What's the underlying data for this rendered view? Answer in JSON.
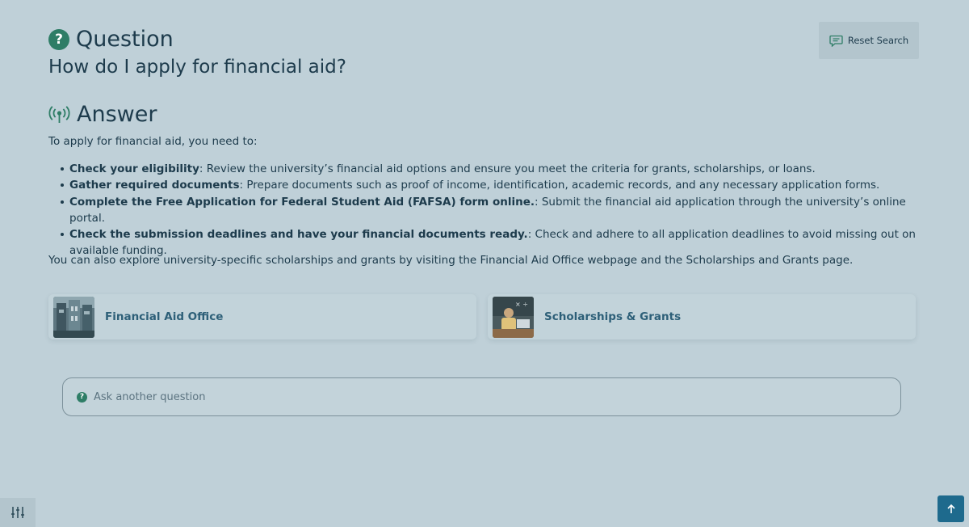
{
  "question": {
    "label": "Question",
    "icon": "question-circle-icon",
    "text": "How do I apply for financial aid?"
  },
  "toolbar": {
    "reset_label": "Reset Search",
    "reset_icon": "chat-bubble-icon"
  },
  "answer": {
    "label": "Answer",
    "icon": "broadcast-icon",
    "intro": "To apply for financial aid, you need to:",
    "items": [
      {
        "bold": "Check your eligibility",
        "text": ": Review the university’s financial aid options and ensure you meet the criteria for grants, scholarships, or loans."
      },
      {
        "bold": "Gather required documents",
        "text": ": Prepare documents such as proof of income, identification, academic records, and any necessary application forms."
      },
      {
        "bold": "Complete the Free Application for Federal Student Aid (FAFSA) form online.",
        "text": ": Submit the financial aid application through the university’s online portal."
      },
      {
        "bold": "Check the submission deadlines and have your financial documents ready.",
        "text": ": Check and adhere to all application deadlines to avoid missing out on available funding."
      }
    ],
    "outro": "You can also explore university-specific scholarships and grants by visiting the Financial Aid Office webpage and the Scholarships and Grants page."
  },
  "links": [
    {
      "title": "Financial Aid Office"
    },
    {
      "title": "Scholarships & Grants"
    }
  ],
  "ask": {
    "placeholder": "Ask another question",
    "icon": "question-circle-icon"
  },
  "controls": {
    "settings_icon": "sliders-icon",
    "scroll_top_icon": "arrow-up-icon"
  },
  "colors": {
    "background": "#bfd0d8",
    "accent": "#2e7d66",
    "link": "#2d5f78",
    "primary_button": "#1e6a8d"
  }
}
